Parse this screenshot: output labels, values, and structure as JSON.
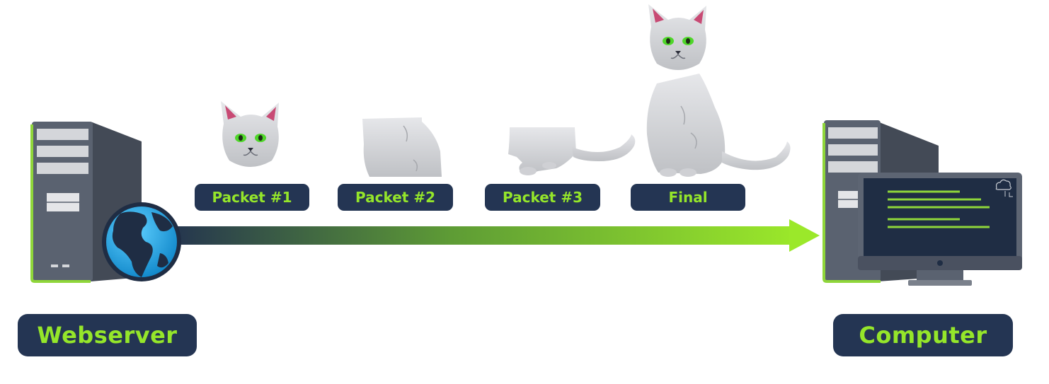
{
  "nodes": {
    "source": {
      "label": "Webserver"
    },
    "destination": {
      "label": "Computer"
    }
  },
  "packets": [
    {
      "label": "Packet #1"
    },
    {
      "label": "Packet #2"
    },
    {
      "label": "Packet #3"
    },
    {
      "label": "Final"
    }
  ],
  "colors": {
    "label_bg": "#243553",
    "label_text": "#95e62a",
    "arrow_start": "#24344f",
    "arrow_end": "#9be82a",
    "tower_body": "#5a6270",
    "tower_side": "#434a56",
    "accent_green": "#8fd63a",
    "globe_water": "#1aa3e6",
    "globe_land": "#1f2d44",
    "cat_fur": "#d9dadd",
    "cat_eye": "#4fd62a"
  },
  "icons": [
    "server-tower-icon",
    "globe-icon",
    "monitor-icon",
    "cloud-sync-icon",
    "cat-image"
  ]
}
